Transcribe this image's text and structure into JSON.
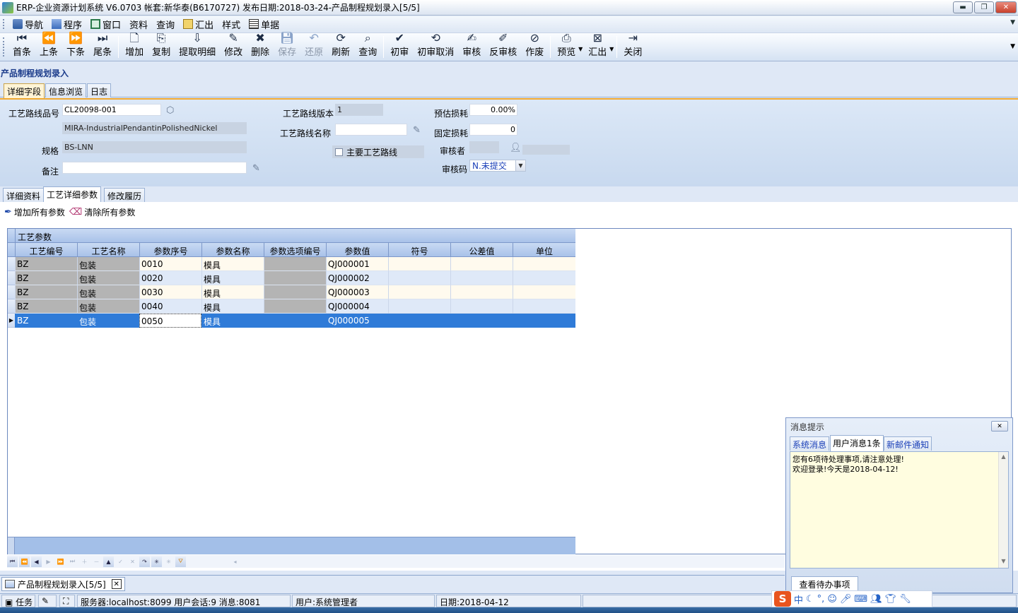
{
  "window": {
    "title": "ERP-企业资源计划系统 V6.0703 帐套:新华泰(B6170727) 发布日期:2018-03-24-产品制程规划录入[5/5]",
    "buttons": {
      "minimize": "▬",
      "restore": "❐",
      "close": "✕"
    }
  },
  "menubar": {
    "items": [
      {
        "label": "导航",
        "icon": "navigation-icon"
      },
      {
        "label": "程序",
        "icon": "program-icon"
      },
      {
        "label": "窗口",
        "icon": "window-icon"
      },
      {
        "label": "资料",
        "icon": ""
      },
      {
        "label": "查询",
        "icon": ""
      },
      {
        "label": "汇出",
        "icon": "export-icon"
      },
      {
        "label": "样式",
        "icon": ""
      },
      {
        "label": "单据",
        "icon": "document-icon"
      }
    ]
  },
  "toolbar": {
    "first": "首条",
    "prev": "上条",
    "next": "下条",
    "last": "尾条",
    "add": "增加",
    "copy": "复制",
    "fetch_detail": "提取明细",
    "edit": "修改",
    "delete": "删除",
    "save": "保存",
    "restore": "还原",
    "refresh": "刷新",
    "query": "查询",
    "first_audit": "初审",
    "cancel_first_audit": "初审取消",
    "audit": "审核",
    "unaudit": "反审核",
    "void": "作废",
    "preview": "预览",
    "export": "汇出",
    "close": "关闭"
  },
  "page": {
    "title": "产品制程规划录入"
  },
  "top_tabs": [
    "详细字段",
    "信息浏览",
    "日志"
  ],
  "form": {
    "route_no_label": "工艺路线品号",
    "route_no_value": "CL20098-001",
    "description_value": "MIRA-IndustrialPendantinPolishedNickel",
    "spec_label": "规格",
    "spec_value": "BS-LNN",
    "remark_label": "备注",
    "remark_value": "",
    "version_label": "工艺路线版本",
    "version_value": "1",
    "route_name_label": "工艺路线名称",
    "route_name_value": "",
    "main_route_label": "主要工艺路线",
    "est_loss_label": "预估损耗",
    "est_loss_value": "0.00%",
    "fixed_loss_label": "固定损耗",
    "fixed_loss_value": "0",
    "auditor_label": "审核者",
    "auditor_value": "",
    "audit_code_label": "审核码",
    "audit_code_value": "N.未提交"
  },
  "detail_tabs": [
    "详细资料",
    "工艺详细参数",
    "修改履历"
  ],
  "actions": {
    "add_all": "增加所有参数",
    "clear_all": "清除所有参数"
  },
  "grid": {
    "band_title": "工艺参数",
    "columns": [
      "工艺编号",
      "工艺名称",
      "参数序号",
      "参数名称",
      "参数选项编号",
      "参数值",
      "符号",
      "公差值",
      "单位"
    ],
    "rows": [
      [
        "BZ",
        "包装",
        "0010",
        "模具",
        "",
        "QJ000001",
        "",
        "",
        ""
      ],
      [
        "BZ",
        "包装",
        "0020",
        "模具",
        "",
        "QJ000002",
        "",
        "",
        ""
      ],
      [
        "BZ",
        "包装",
        "0030",
        "模具",
        "",
        "QJ000003",
        "",
        "",
        ""
      ],
      [
        "BZ",
        "包装",
        "0040",
        "模具",
        "",
        "QJ000004",
        "",
        "",
        ""
      ],
      [
        "BZ",
        "包装",
        "0050",
        "模具",
        "",
        "QJ000005",
        "",
        "",
        ""
      ]
    ],
    "selected_row_marker": "▶"
  },
  "doc_tab": {
    "label": "产品制程规划录入[5/5]",
    "close": "✕"
  },
  "statusbar": {
    "task": "任务",
    "server": "服务器:localhost:8099 用户会话:9 消息:8081",
    "user": "用户:系统管理者",
    "date": "日期:2018-04-12"
  },
  "message_box": {
    "title": "消息提示",
    "close": "✕",
    "tabs": [
      "系统消息",
      "用户消息1条",
      "新邮件通知"
    ],
    "lines": [
      "您有6项待处理事项,请注意处理!",
      "欢迎登录!今天是2018-04-12!"
    ],
    "button": "查看待办事项"
  },
  "ime": {
    "logo": "S",
    "mode": "中"
  }
}
